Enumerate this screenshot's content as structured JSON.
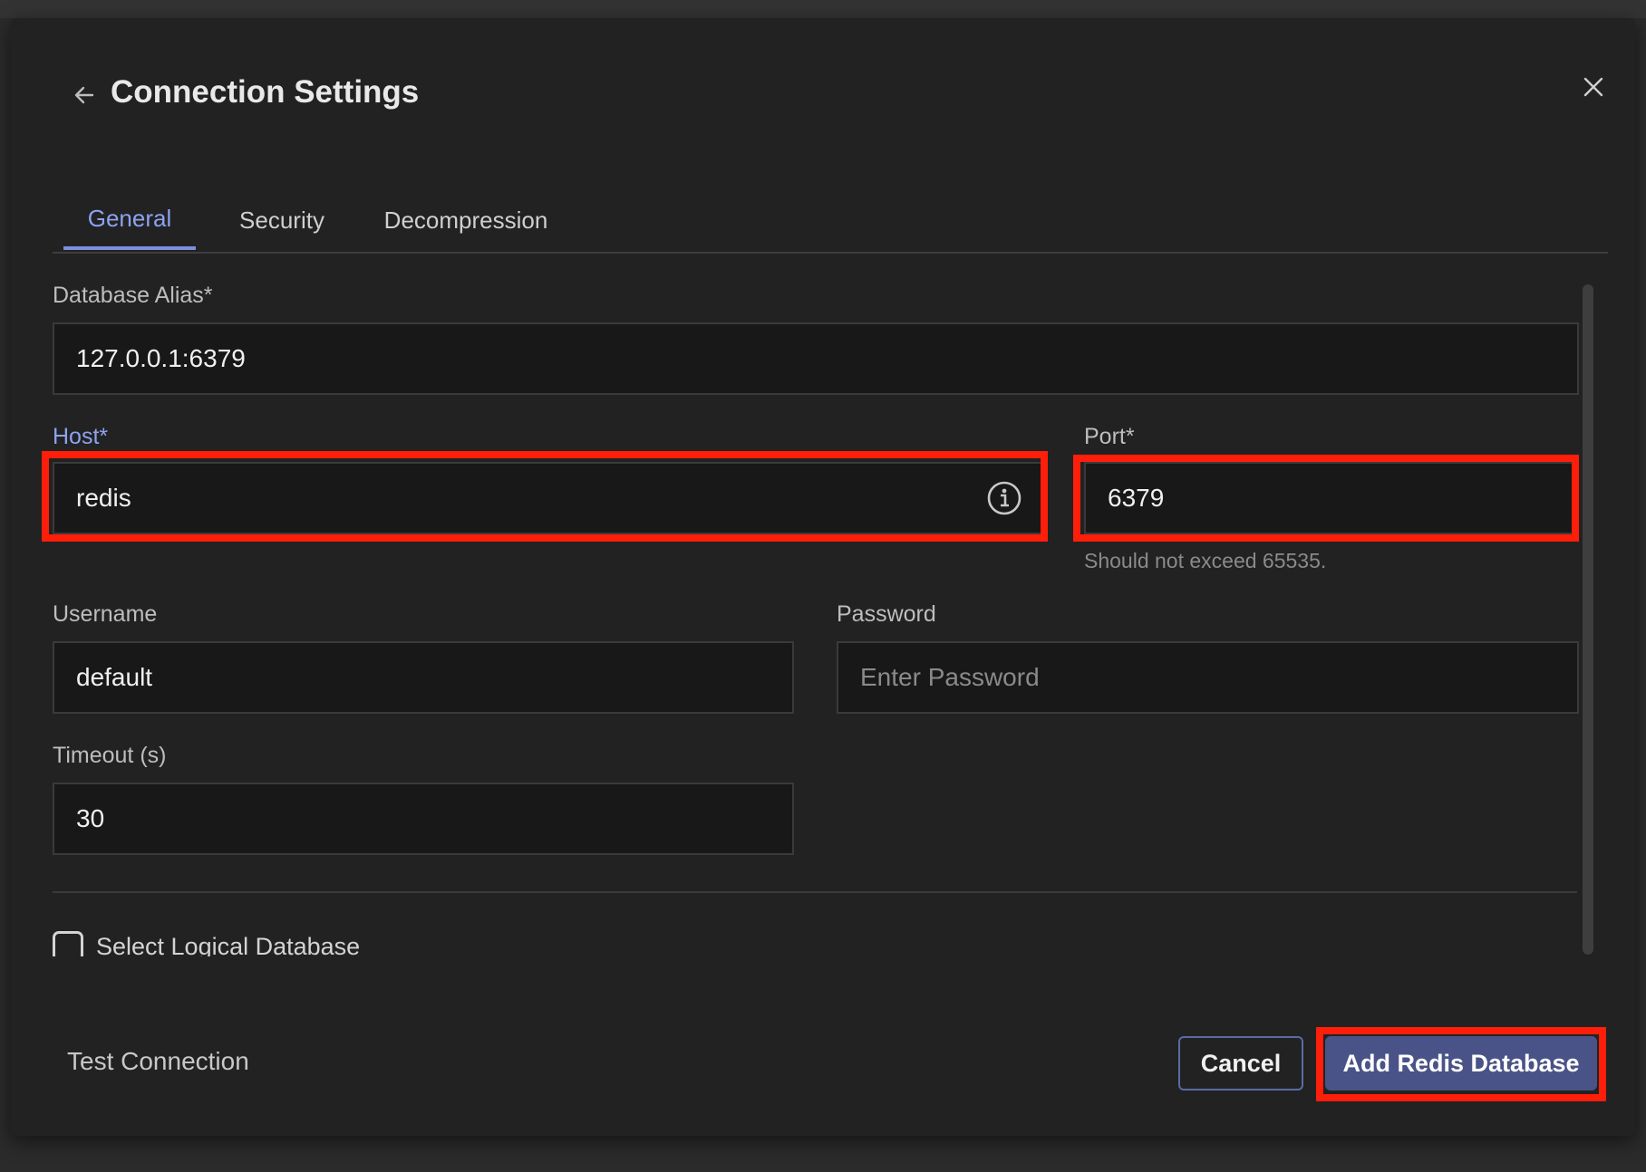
{
  "dialog": {
    "title": "Connection Settings",
    "back_icon": "arrow-left-icon",
    "close_icon": "close-icon"
  },
  "tabs": [
    {
      "label": "General",
      "active": true
    },
    {
      "label": "Security",
      "active": false
    },
    {
      "label": "Decompression",
      "active": false
    }
  ],
  "form": {
    "alias": {
      "label": "Database Alias*",
      "value": "127.0.0.1:6379"
    },
    "host": {
      "label": "Host*",
      "value": "redis",
      "icon": "info-icon"
    },
    "port": {
      "label": "Port*",
      "value": "6379",
      "hint": "Should not exceed 65535."
    },
    "username": {
      "label": "Username",
      "value": "default"
    },
    "password": {
      "label": "Password",
      "placeholder": "Enter Password"
    },
    "timeout": {
      "label": "Timeout (s)",
      "value": "30"
    },
    "logical_db": {
      "label": "Select Logical Database",
      "checked": false
    }
  },
  "footer": {
    "test_label": "Test Connection",
    "cancel_label": "Cancel",
    "submit_label": "Add Redis Database"
  },
  "colors": {
    "accent": "#8da2f0",
    "primary_button": "#4a5387",
    "highlight": "#ff1e0a",
    "dialog_bg": "#222222",
    "field_bg": "#181818"
  }
}
